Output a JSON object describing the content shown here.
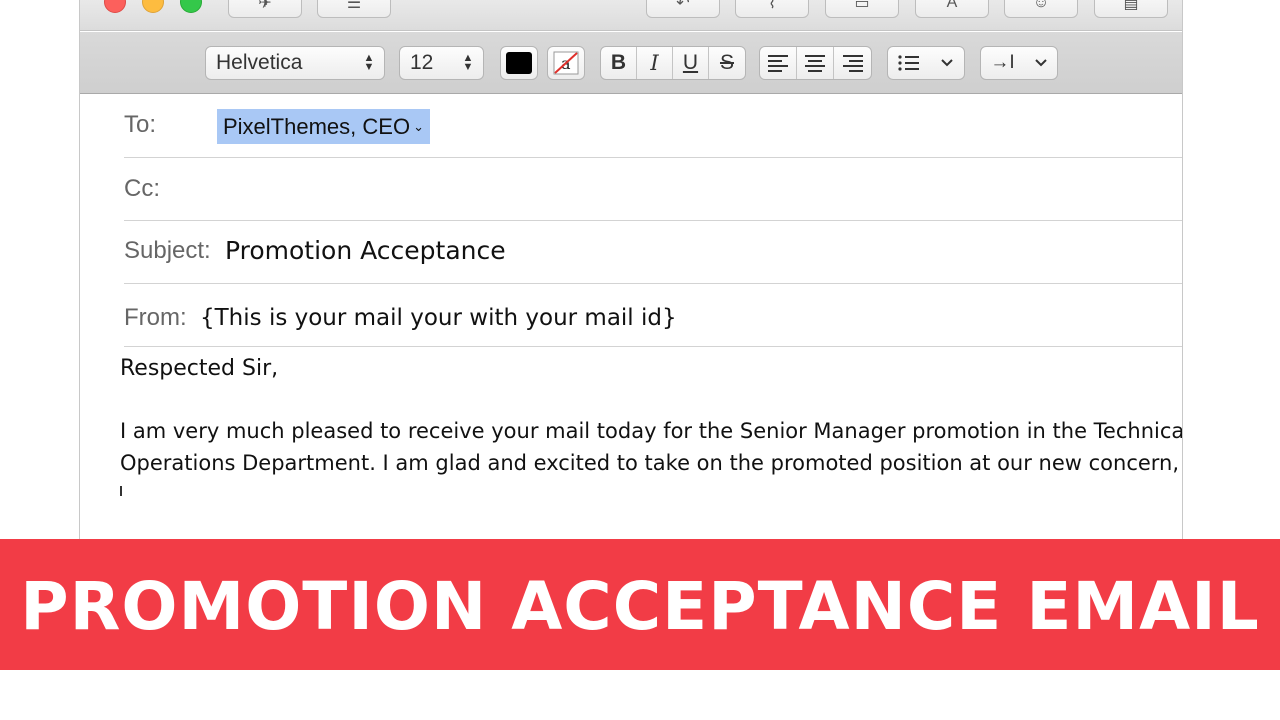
{
  "format_bar": {
    "font_family": "Helvetica",
    "font_size": "12",
    "text_color": "#000000",
    "bold_label": "B",
    "italic_label": "I",
    "underline_label": "U",
    "strike_label": "S",
    "indent_label": "→I"
  },
  "header": {
    "to_label": "To:",
    "to_value": "PixelThemes, CEO",
    "cc_label": "Cc:",
    "subject_label": "Subject:",
    "subject_value": "Promotion Acceptance",
    "from_label": "From:",
    "from_value": "{This is your mail your with your mail id}"
  },
  "body": {
    "greeting": "Respected Sir,",
    "line1": "I am very much pleased to receive your mail today for the Senior Manager promotion in the Technical",
    "line2": "Operations Department. I am glad and excited to take on the promoted position at our new concern,"
  },
  "banner": {
    "title": "PROMOTION ACCEPTANCE EMAIL",
    "background": "#f23c46"
  },
  "colors": {
    "selection": "#a9c8f5",
    "accent_red": "#f23c46"
  }
}
